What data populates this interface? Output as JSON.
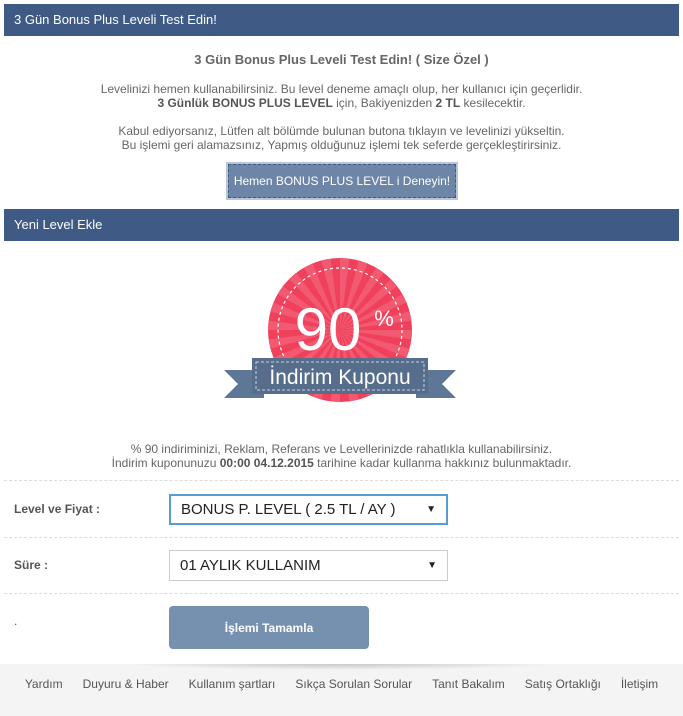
{
  "promo": {
    "header": "3 Gün Bonus Plus Leveli Test Edin!",
    "title": "3 Gün Bonus Plus Leveli Test Edin! ( Size Özel )",
    "p1_line1": "Levelinizi hemen kullanabilirsiniz. Bu level deneme amaçlı olup, her kullanıcı için geçerlidir.",
    "p1_bold_a": "3 Günlük BONUS PLUS LEVEL",
    "p1_text_b": " için, Bakiyenizden ",
    "p1_bold_c": "2 TL",
    "p1_text_d": " kesilecektir.",
    "p2_line1": "Kabul ediyorsanız, Lütfen alt bölümde bulunan butona tıklayın ve levelinizi yükseltin.",
    "p2_line2": "Bu işlemi geri alamazsınız, Yapmış olduğunuz işlemi tek seferde gerçekleştirirsiniz.",
    "button": "Hemen BONUS PLUS LEVEL i Deneyin!"
  },
  "new_level": {
    "header": "Yeni Level Ekle",
    "coupon_percent": "90",
    "coupon_percent_sign": "%",
    "coupon_label": "İndirim Kuponu",
    "note_line1": "% 90 indiriminizi, Reklam, Referans ve Levellerinizde rahatlıkla kullanabilirsiniz.",
    "note_a": "İndirim kuponunuzu ",
    "note_date": "00:00 04.12.2015",
    "note_b": " tarihine kadar kullanma hakkınız bulunmaktadır."
  },
  "form": {
    "level_label": "Level ve Fiyat :",
    "level_value": "BONUS P. LEVEL ( 2.5 TL / AY )",
    "duration_label": "Süre :",
    "duration_value": "01 AYLIK KULLANIM",
    "dot": ".",
    "submit": "İşlemi Tamamla"
  },
  "footer": {
    "links": [
      "Yardım",
      "Duyuru & Haber",
      "Kullanım şartları",
      "Sıkça Sorulan Sorular",
      "Tanıt Bakalım",
      "Satış Ortaklığı",
      "İletişim"
    ]
  },
  "colors": {
    "header_bg": "#3f5b85",
    "button_bg": "#7690b0",
    "coupon_red": "#f0405c",
    "ribbon": "#5f7796"
  }
}
